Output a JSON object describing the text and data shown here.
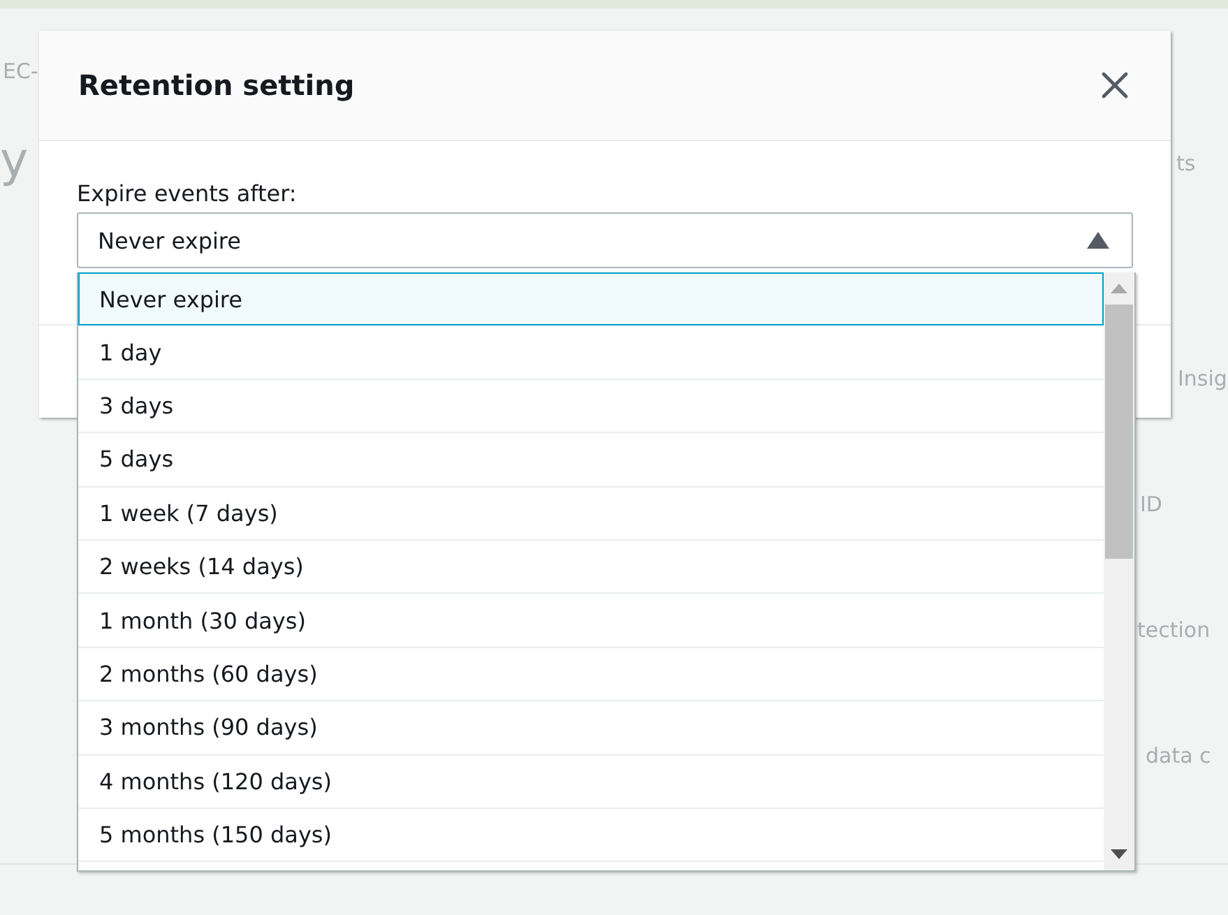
{
  "background": {
    "texts": [
      {
        "text": "EC-",
        "kind": "small"
      },
      {
        "text": "y",
        "kind": "large"
      },
      {
        "text": "ts",
        "kind": "small"
      },
      {
        "text": "Insig",
        "kind": "small"
      },
      {
        "text": "ID",
        "kind": "small"
      },
      {
        "text": "tection",
        "kind": "small"
      },
      {
        "text": "data c",
        "kind": "small"
      }
    ]
  },
  "dialog": {
    "title": "Retention setting",
    "field_label": "Expire events after:",
    "select": {
      "value": "Never expire",
      "expanded": true
    },
    "options": [
      {
        "label": "Never expire",
        "selected": true
      },
      {
        "label": "1 day",
        "selected": false
      },
      {
        "label": "3 days",
        "selected": false
      },
      {
        "label": "5 days",
        "selected": false
      },
      {
        "label": "1 week (7 days)",
        "selected": false
      },
      {
        "label": "2 weeks (14 days)",
        "selected": false
      },
      {
        "label": "1 month (30 days)",
        "selected": false
      },
      {
        "label": "2 months (60 days)",
        "selected": false
      },
      {
        "label": "3 months (90 days)",
        "selected": false
      },
      {
        "label": "4 months (120 days)",
        "selected": false
      },
      {
        "label": "5 months (150 days)",
        "selected": false
      }
    ]
  }
}
